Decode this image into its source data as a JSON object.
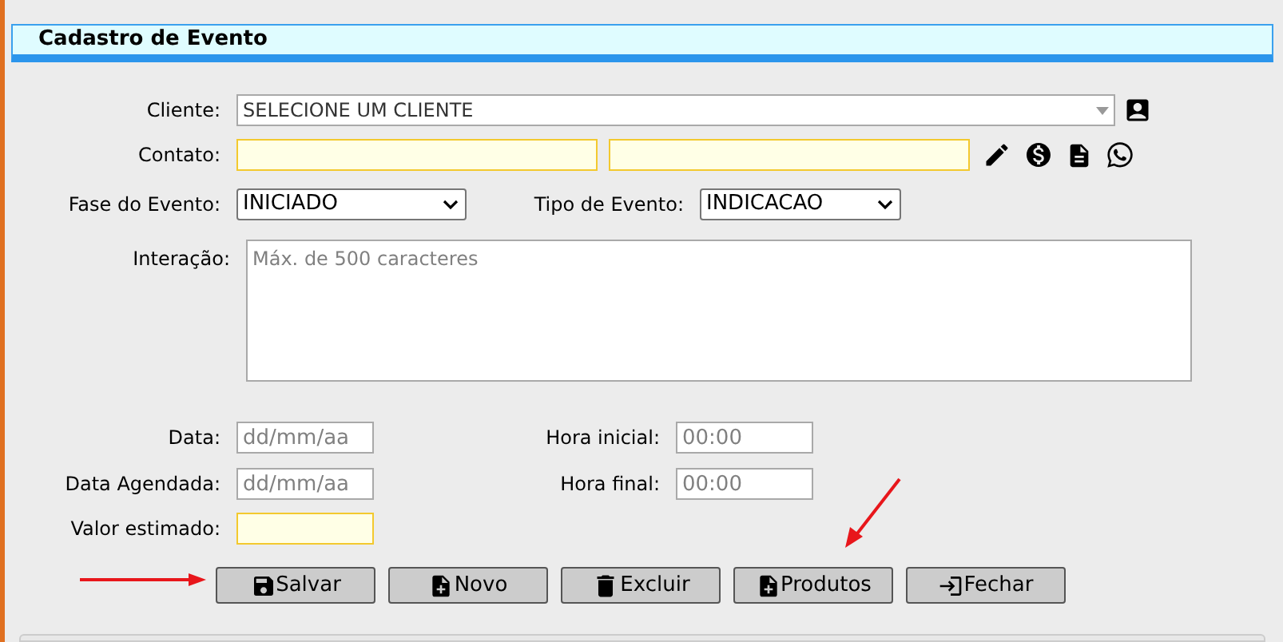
{
  "dialog": {
    "title": "Cadastro de Evento"
  },
  "cliente": {
    "label": "Cliente:",
    "value": "SELECIONE UM CLIENTE"
  },
  "contato": {
    "label": "Contato:"
  },
  "fase": {
    "label": "Fase do Evento:",
    "value": "INICIADO"
  },
  "tipo": {
    "label": "Tipo de Evento:",
    "value": "INDICACAO"
  },
  "interacao": {
    "label": "Interação:",
    "placeholder": "Máx. de 500 caracteres"
  },
  "data": {
    "label": "Data:",
    "placeholder": "dd/mm/aa"
  },
  "hora_inicial": {
    "label": "Hora inicial:",
    "placeholder": "00:00"
  },
  "data_agendada": {
    "label": "Data Agendada:",
    "placeholder": "dd/mm/aa"
  },
  "hora_final": {
    "label": "Hora final:",
    "placeholder": "00:00"
  },
  "valor": {
    "label": "Valor estimado:"
  },
  "buttons": [
    {
      "label": "Salvar",
      "kind": "save"
    },
    {
      "label": "Novo",
      "kind": "new"
    },
    {
      "label": "Excluir",
      "kind": "delete"
    },
    {
      "label": "Produtos",
      "kind": "add"
    },
    {
      "label": "Fechar",
      "kind": "close"
    }
  ]
}
